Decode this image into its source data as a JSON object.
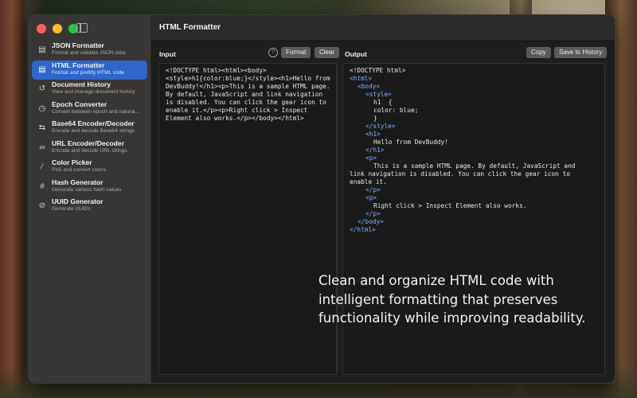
{
  "app": {
    "page_title": "HTML Formatter"
  },
  "sidebar": {
    "items": [
      {
        "title": "JSON Formatter",
        "subtitle": "Format and validate JSON data",
        "icon": "json-doc-icon",
        "active": false
      },
      {
        "title": "HTML Formatter",
        "subtitle": "Format and prettify HTML code",
        "icon": "html-doc-icon",
        "active": true
      },
      {
        "title": "Document History",
        "subtitle": "View and manage document history",
        "icon": "history-icon",
        "active": false
      },
      {
        "title": "Epoch Converter",
        "subtitle": "Convert between epoch and natural...",
        "icon": "clock-icon",
        "active": false
      },
      {
        "title": "Base64 Encoder/Decoder",
        "subtitle": "Encode and decode Base64 strings",
        "icon": "arrows-swap-icon",
        "active": false
      },
      {
        "title": "URL Encoder/Decoder",
        "subtitle": "Encode and decode URL strings",
        "icon": "link-icon",
        "active": false
      },
      {
        "title": "Color Picker",
        "subtitle": "Pick and convert colors",
        "icon": "eyedropper-icon",
        "active": false
      },
      {
        "title": "Hash Generator",
        "subtitle": "Generate various hash values",
        "icon": "hash-icon",
        "active": false
      },
      {
        "title": "UUID Generator",
        "subtitle": "Generate UUIDs",
        "icon": "uuid-icon",
        "active": false
      }
    ]
  },
  "input_pane": {
    "label": "Input",
    "help": "?",
    "format_label": "Format",
    "clear_label": "Clear",
    "text": "<!DOCTYPE html><html><body><style>h1{color:blue;}</style><h1>Hello from DevBuddy!</h1><p>This is a sample HTML page. By default, JavaScript and link navigation is disabled. You can click the gear icon to enable it.</p><p>Right click > Inspect Element also works.</p></body></html>"
  },
  "output_pane": {
    "label": "Output",
    "copy_label": "Copy",
    "save_label": "Save to History",
    "lines": [
      {
        "indent": 0,
        "text": "<!DOCTYPE html>",
        "kind": "plain"
      },
      {
        "indent": 0,
        "text": "<html>",
        "kind": "tag"
      },
      {
        "indent": 1,
        "text": "<body>",
        "kind": "tag"
      },
      {
        "indent": 2,
        "text": "<style>",
        "kind": "tag"
      },
      {
        "indent": 3,
        "text": "h1  {",
        "kind": "plain"
      },
      {
        "indent": 3,
        "text": "color: blue;",
        "kind": "plain"
      },
      {
        "indent": 3,
        "text": "}",
        "kind": "plain"
      },
      {
        "indent": 2,
        "text": "</style>",
        "kind": "tag"
      },
      {
        "indent": 2,
        "text": "<h1>",
        "kind": "tag"
      },
      {
        "indent": 3,
        "text": "Hello from DevBuddy!",
        "kind": "plain"
      },
      {
        "indent": 2,
        "text": "</h1>",
        "kind": "tag"
      },
      {
        "indent": 2,
        "text": "<p>",
        "kind": "tag"
      },
      {
        "indent": 3,
        "text": "This is a sample HTML page. By default, JavaScript and",
        "kind": "plain"
      },
      {
        "indent": 0,
        "text": "link navigation is disabled. You can click the gear icon to",
        "kind": "plain"
      },
      {
        "indent": 0,
        "text": "enable it.",
        "kind": "plain"
      },
      {
        "indent": 2,
        "text": "</p>",
        "kind": "tag"
      },
      {
        "indent": 2,
        "text": "<p>",
        "kind": "tag"
      },
      {
        "indent": 3,
        "text": "Right click > Inspect Element also works.",
        "kind": "plain"
      },
      {
        "indent": 2,
        "text": "</p>",
        "kind": "tag"
      },
      {
        "indent": 1,
        "text": "</body>",
        "kind": "tag"
      },
      {
        "indent": 0,
        "text": "</html>",
        "kind": "tag"
      }
    ]
  },
  "caption": "Clean and organize HTML code with intelligent formatting that preserves functionality while improving readability.",
  "colors": {
    "accent": "#2f66c8",
    "tag": "#7cb0ff"
  }
}
